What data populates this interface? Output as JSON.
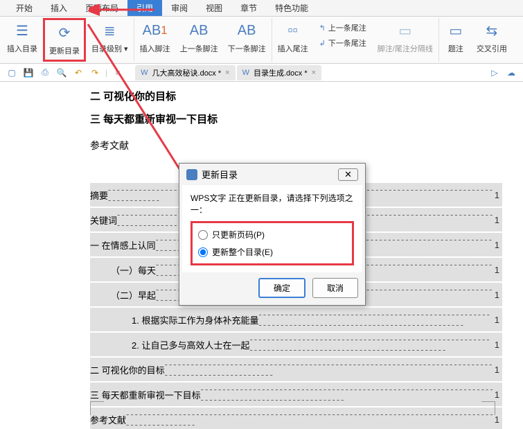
{
  "menu": {
    "items": [
      "开始",
      "插入",
      "页面布局",
      "引用",
      "审阅",
      "视图",
      "章节",
      "特色功能"
    ],
    "active_index": 3
  },
  "ribbon": {
    "insert_toc": "插入目录",
    "update_toc": "更新目录",
    "toc_level": "目录级别",
    "insert_footnote": "插入脚注",
    "prev_footnote": "上一条脚注",
    "next_footnote": "下一条脚注",
    "insert_endnote": "插入尾注",
    "prev_endnote": "上一条尾注",
    "next_endnote": "下一条尾注",
    "footnote_sep": "脚注/尾注分隔线",
    "caption": "题注",
    "cross_ref": "交叉引用"
  },
  "tabs": [
    {
      "label": "几大高效秘诀.docx *"
    },
    {
      "label": "目录生成.docx *"
    }
  ],
  "document": {
    "heading1": "二 可视化你的目标",
    "heading2": "三 每天都重新审视一下目标",
    "heading3": "参考文献",
    "toc": [
      {
        "text": "摘要",
        "indent": 0,
        "page": "1"
      },
      {
        "text": "关键词",
        "indent": 0,
        "page": "1"
      },
      {
        "text": "一 在情感上认同",
        "indent": 0,
        "page": "1"
      },
      {
        "text": "（一）每天",
        "indent": 1,
        "page": "1"
      },
      {
        "text": "（二）早起",
        "indent": 1,
        "page": "1"
      },
      {
        "text": "1. 根据实际工作为身体补充能量",
        "indent": 2,
        "page": "1"
      },
      {
        "text": "2. 让自己多与高效人士在一起",
        "indent": 2,
        "page": "1"
      },
      {
        "text": "二 可视化你的目标",
        "indent": 0,
        "page": "1"
      },
      {
        "text": "三 每天都重新审视一下目标",
        "indent": 0,
        "page": "1"
      },
      {
        "text": "参考文献",
        "indent": 0,
        "page": "1"
      }
    ]
  },
  "dialog": {
    "title": "更新目录",
    "prompt": "WPS文字 正在更新目录，请选择下列选项之一：",
    "option1": "只更新页码(P)",
    "option2": "更新整个目录(E)",
    "ok": "确定",
    "cancel": "取消"
  }
}
